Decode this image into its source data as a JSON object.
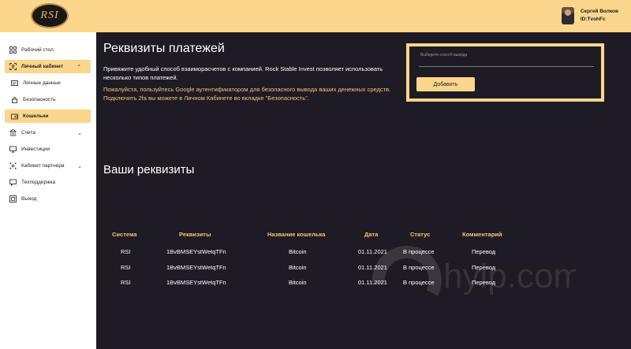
{
  "header": {
    "logo_text": "RSI",
    "user_name": "Сергей Волков",
    "user_id": "ID:TvohFc"
  },
  "sidebar": {
    "items": [
      {
        "label": "Рабочий стол",
        "icon": "dashboard-icon"
      },
      {
        "label": "Личный кабинет",
        "icon": "user-icon",
        "active": true
      },
      {
        "label": "Личные данные",
        "icon": "id-card-icon"
      },
      {
        "label": "Безопасность",
        "icon": "lock-icon"
      },
      {
        "label": "Кошельки",
        "icon": "wallet-icon",
        "active": true
      },
      {
        "label": "Счета",
        "icon": "bank-icon"
      },
      {
        "label": "Инвестиции",
        "icon": "monitor-icon"
      },
      {
        "label": "Кабинет партнера",
        "icon": "network-icon"
      },
      {
        "label": "Техподдержка",
        "icon": "support-icon"
      },
      {
        "label": "Выход",
        "icon": "exit-icon"
      }
    ]
  },
  "main": {
    "title": "Реквизиты платежей",
    "description": "Привяжите удобный способ взаиморасчетов с компанией. Rock Stable Invest позволяет использовать несколько типов платежей.",
    "note": "Пожалуйста, пользуйтесь Google аутентификатором для безопасного вывода ваших денежных средств. Подключить 2fa вы можете в Личном Кабинете во вкладке \"Безопасность\".",
    "select_placeholder": "Выберите способ вывода",
    "add_button": "Добавить",
    "section_title": "Ваши реквизиты"
  },
  "table": {
    "headers": [
      "Система",
      "Реквизиты",
      "Название кошелька",
      "Дата",
      "Статус",
      "Комментарий"
    ],
    "rows": [
      [
        "RSI",
        "1BvBMSEYstWetqTFn",
        "Bitcoin",
        "01.11.2021",
        "В процессе",
        "Перевод"
      ],
      [
        "RSI",
        "1BvBMSEYstWetqTFn",
        "Bitcoin",
        "01.11.2021",
        "В процессе",
        "Перевод"
      ],
      [
        "RSI",
        "1BvBMSEYstWetqTFn",
        "Bitcoin",
        "01.11.2021",
        "В процессе",
        "Перевод"
      ]
    ]
  },
  "watermark": "hyip.com",
  "colors": {
    "accent": "#fcd68c",
    "background": "#1f1b24",
    "note_text": "#f2c47a"
  }
}
